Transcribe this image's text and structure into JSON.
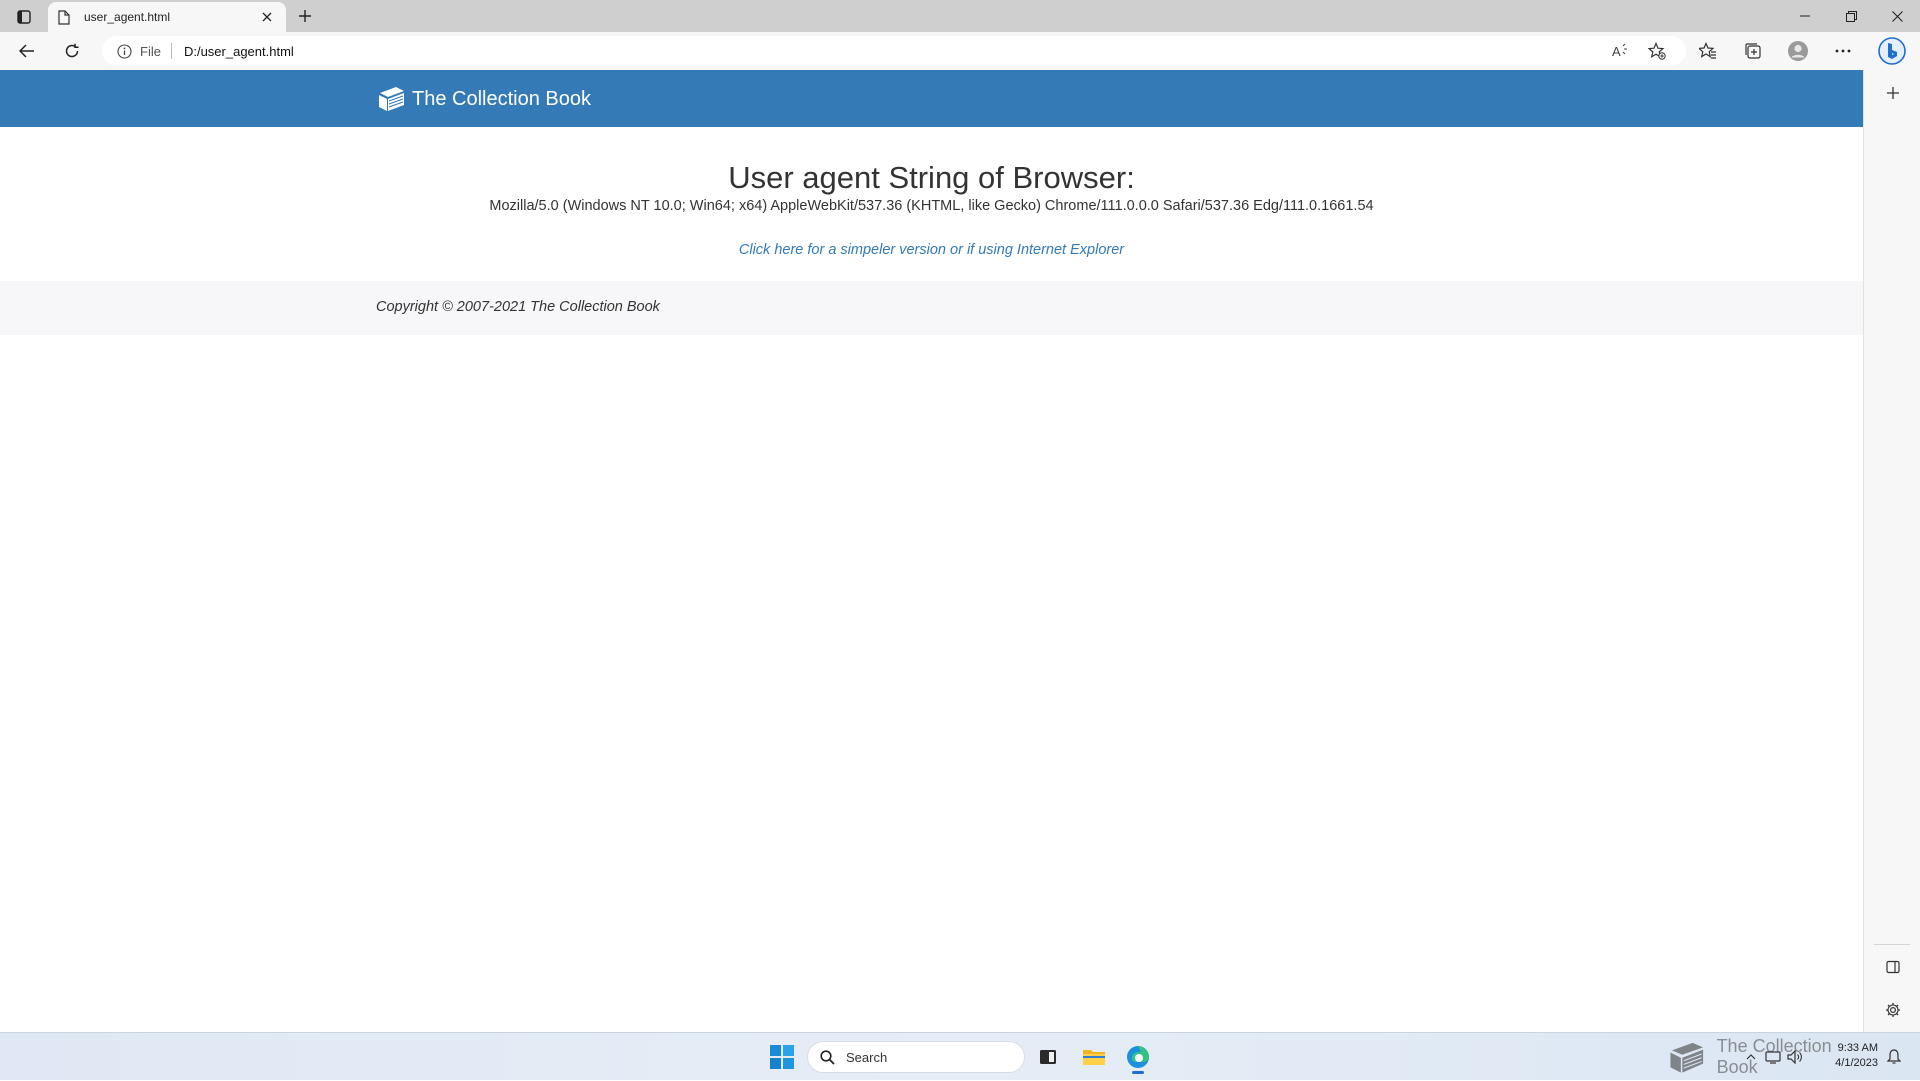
{
  "browser": {
    "tab": {
      "title": "user_agent.html"
    },
    "address": {
      "scheme": "File",
      "url": "D:/user_agent.html"
    }
  },
  "page": {
    "brand": "The Collection Book",
    "title": "User agent String of Browser:",
    "user_agent": "Mozilla/5.0 (Windows NT 10.0; Win64; x64) AppleWebKit/537.36 (KHTML, like Gecko) Chrome/111.0.0.0 Safari/537.36 Edg/111.0.1661.54",
    "simple_link": "Click here for a simpeler version or if using Internet Explorer",
    "copyright": "Copyright © 2007-2021 The Collection Book"
  },
  "taskbar": {
    "search_placeholder": "Search",
    "clock": {
      "time": "9:33 AM",
      "date": "4/1/2023"
    },
    "watermark": "The Collection Book"
  },
  "colors": {
    "header_blue": "#337ab7",
    "link_blue": "#337ab7",
    "footer_bg": "#f7f7f9"
  },
  "icons": {
    "tab_actions": "tab-actions-icon",
    "favicon": "page-icon",
    "close": "close-icon",
    "new_tab": "plus-icon",
    "back": "back-arrow-icon",
    "refresh": "refresh-icon",
    "info": "info-icon",
    "read_aloud": "read-aloud-icon",
    "add_favorite": "add-favorite-icon",
    "favorites": "favorites-icon",
    "collections": "collections-icon",
    "profile": "profile-icon",
    "more": "more-icon",
    "bing": "bing-icon",
    "brand": "book-icon"
  }
}
